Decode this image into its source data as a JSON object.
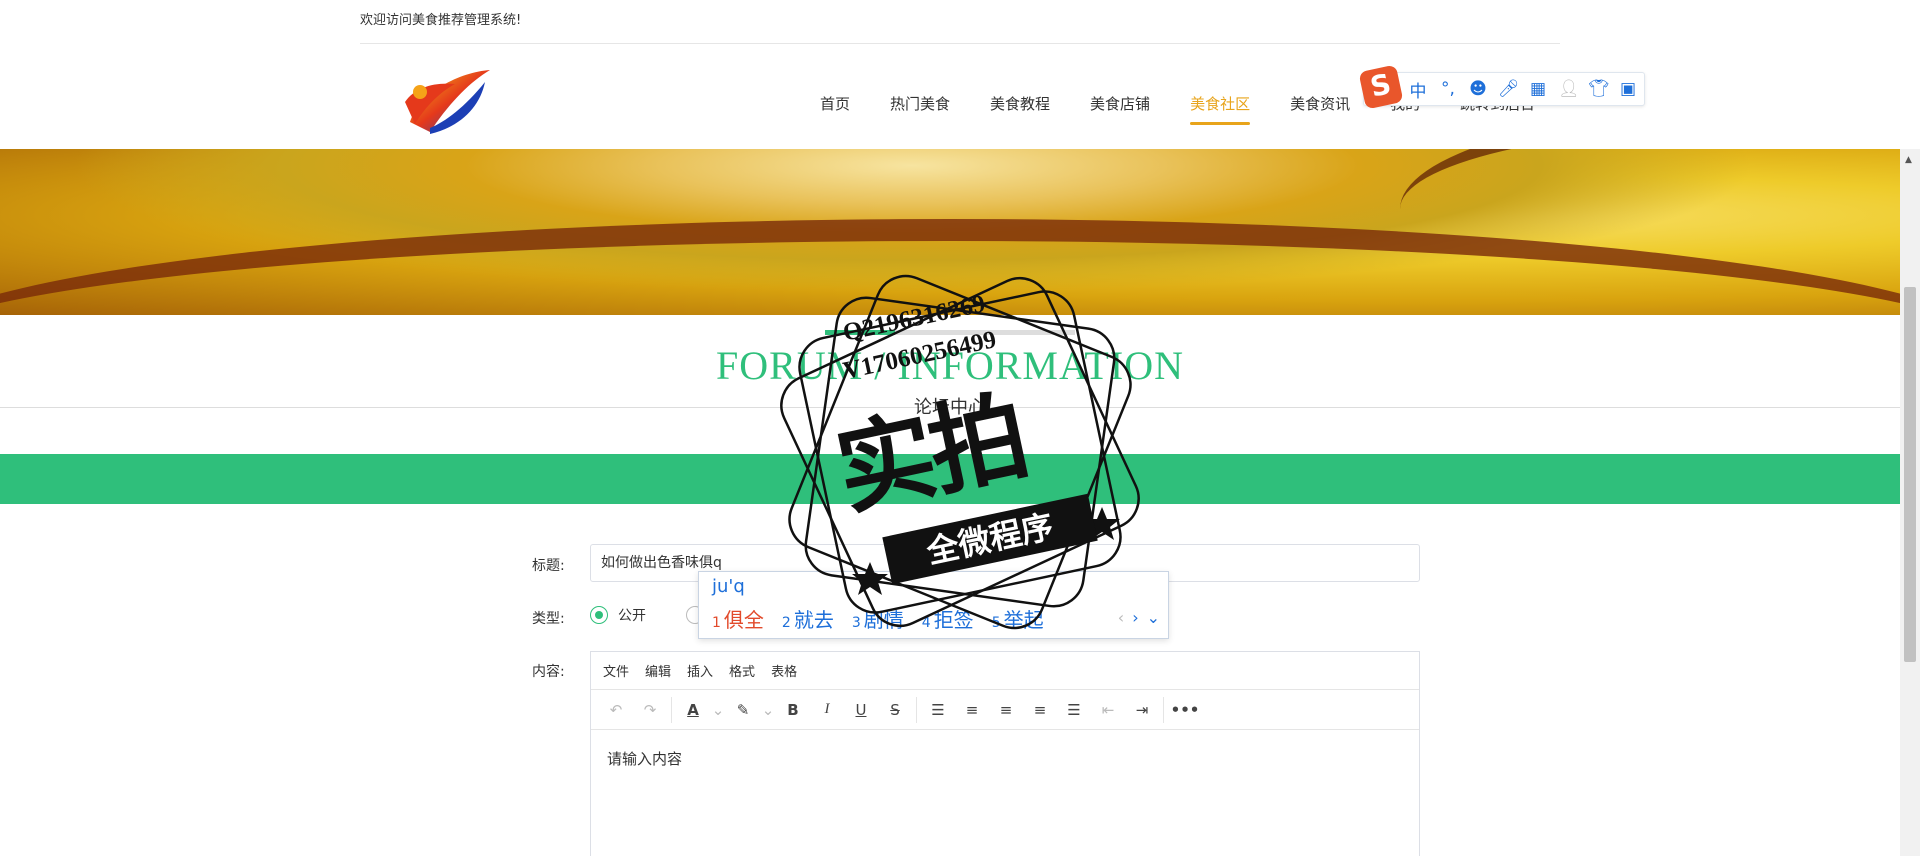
{
  "topbar": {
    "welcome": "欢迎访问美食推荐管理系统!"
  },
  "nav": {
    "items": [
      {
        "label": "首页"
      },
      {
        "label": "热门美食"
      },
      {
        "label": "美食教程"
      },
      {
        "label": "美食店铺"
      },
      {
        "label": "美食社区",
        "active": true
      },
      {
        "label": "美食资讯"
      },
      {
        "label": "我的"
      },
      {
        "label": "跳转到后台"
      }
    ],
    "active_color": "#e8a41b"
  },
  "ime_bar": {
    "logo": "S",
    "mode": "中",
    "punct": "°,"
  },
  "section": {
    "title_en": "FORUM / INFORMATION",
    "title_cn": "论坛中心"
  },
  "form": {
    "title_label": "标题:",
    "title_value": "如何做出色香味俱q",
    "type_label": "类型:",
    "type_public": "公开",
    "content_label": "内容:",
    "editor_menu": [
      "文件",
      "编辑",
      "插入",
      "格式",
      "表格"
    ],
    "content_placeholder": "请输入内容"
  },
  "ime_popup": {
    "pinyin": "ju'q",
    "candidates": [
      {
        "num": "1",
        "text": "俱全"
      },
      {
        "num": "2",
        "text": "就去"
      },
      {
        "num": "3",
        "text": "剧情"
      },
      {
        "num": "4",
        "text": "拒签"
      },
      {
        "num": "5",
        "text": "举起"
      }
    ]
  },
  "watermark": {
    "line1": "Q2196316269",
    "line2": "V17060256499",
    "main": "实拍",
    "banner": "全微程序"
  },
  "colors": {
    "accent": "#2fbf7b",
    "ime_blue": "#1e6fd9"
  }
}
